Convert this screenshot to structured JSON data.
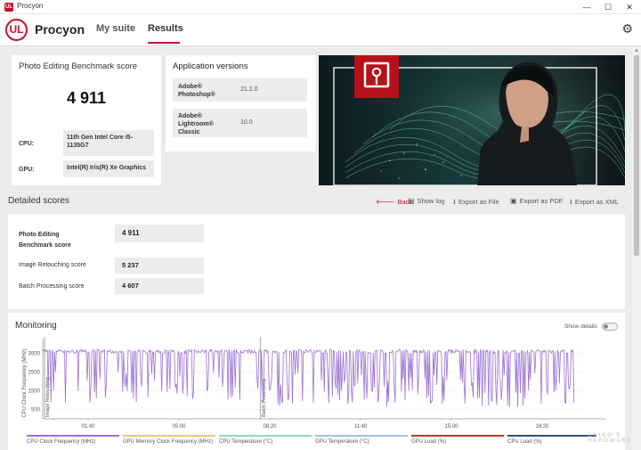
{
  "window": {
    "title": "Procyon",
    "minimize": "—",
    "maximize": "☐",
    "close": "✕"
  },
  "header": {
    "logo": "UL",
    "brand": "Procyon",
    "tabs": [
      {
        "label": "My suite"
      },
      {
        "label": "Results"
      }
    ],
    "active_tab": "Results"
  },
  "score_card": {
    "title": "Photo Editing Benchmark score",
    "score": "4 911",
    "cpu_label": "CPU:",
    "cpu_value": "11th Gen Intel Core i5-1135G7",
    "gpu_label": "GPU:",
    "gpu_value": "Intel(R) Iris(R) Xe Graphics"
  },
  "app_versions": {
    "title": "Application versions",
    "items": [
      {
        "name": "Adobe® Photoshop®",
        "version": "21.2.0"
      },
      {
        "name": "Adobe® Lightroom® Classic",
        "version": "10.0"
      }
    ]
  },
  "detailed": {
    "title": "Detailed scores",
    "actions": [
      {
        "label": "Back",
        "icon": "back-arrow-icon"
      },
      {
        "label": "Show log",
        "icon": "document-icon"
      },
      {
        "label": "Export as File",
        "icon": "download-icon"
      },
      {
        "label": "Export as PDF",
        "icon": "save-icon"
      },
      {
        "label": "Export as XML",
        "icon": "download-icon"
      }
    ],
    "rows": [
      {
        "label": "Photo Editing Benchmark score",
        "value": "4 911"
      },
      {
        "label": "Image Retouching score",
        "value": "5 237"
      },
      {
        "label": "Batch Processing score",
        "value": "4 607"
      }
    ]
  },
  "monitoring": {
    "title": "Monitoring",
    "show_details": "Show details",
    "y_axis_label": "CPU Clock Frequency (MHz)",
    "phase_labels": [
      "Image Retouching",
      "Batch Processing"
    ],
    "legend": [
      {
        "label": "CPU Clock Frequency (MHz)",
        "color": "#9b6fd3"
      },
      {
        "label": "GPU Memory Clock Frequency (MHz)",
        "color": "#e8c77a"
      },
      {
        "label": "CPU Temperature (°C)",
        "color": "#8fd9c8"
      },
      {
        "label": "GPU Temperature (°C)",
        "color": "#9fc3e6"
      },
      {
        "label": "GPU Load (%)",
        "color": "#c0392b"
      },
      {
        "label": "CPU Load (%)",
        "color": "#2f4f8a"
      }
    ]
  },
  "chart_data": {
    "type": "line",
    "series": [
      {
        "name": "CPU Clock Frequency (MHz)"
      }
    ],
    "y_ticks": [
      "3500",
      "2500",
      "1500",
      "500"
    ],
    "x_ticks": [
      "01:40",
      "05:00",
      "08:20",
      "11:40",
      "15:00",
      "18:20"
    ],
    "ylim": [
      0,
      4000
    ],
    "segments": [
      {
        "x_start": "00:00",
        "x_end": "08:00",
        "baseline_mhz": 3700,
        "min_mhz": 800
      },
      {
        "x_start": "08:00",
        "x_end": "19:30",
        "baseline_mhz": 3700,
        "min_mhz": 600
      }
    ]
  },
  "watermark": "UNIKO'S HARDWARE"
}
